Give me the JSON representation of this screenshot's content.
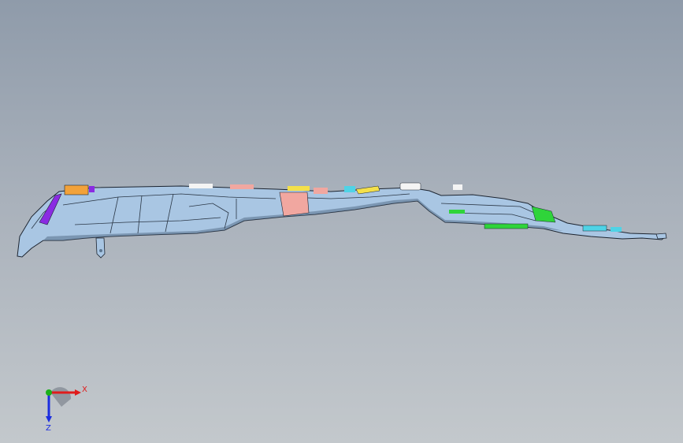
{
  "viewport": {
    "background_top": "#8f9baa",
    "background_bottom": "#c3c8cc"
  },
  "model": {
    "name": "",
    "colors": {
      "body": "#a9c6e3",
      "body_dark": "#5d7791",
      "edge": "#1c2430",
      "orange": "#f2a23a",
      "purple": "#8a2be2",
      "pink": "#f1a7a0",
      "yellow": "#f4e04a",
      "cyan": "#4fd3e6",
      "green": "#2fd43a",
      "white": "#f4f4f4"
    }
  },
  "triad": {
    "x_label": "X",
    "y_label": "Z",
    "x_color": "#e01b1b",
    "z_color": "#1b2de0",
    "y_color": "#1bb01b"
  }
}
